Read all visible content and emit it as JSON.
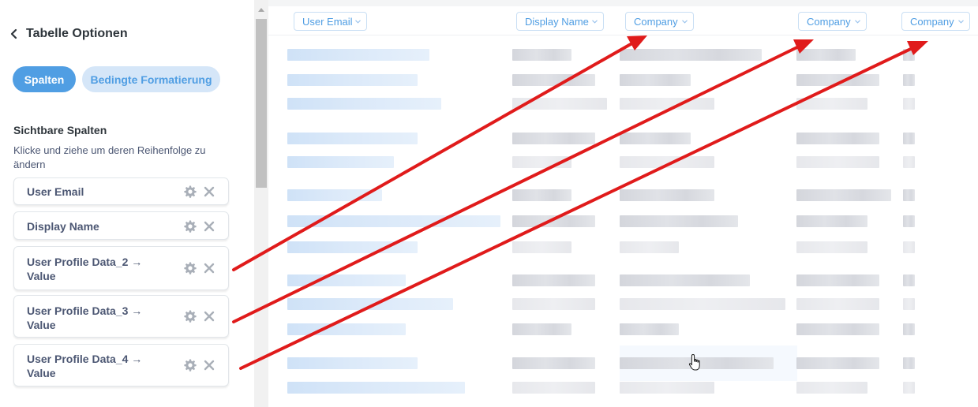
{
  "panel": {
    "title": "Tabelle Optionen",
    "tabs": {
      "active": "Spalten",
      "inactive": "Bedingte Formatierung"
    },
    "section_title": "Sichtbare Spalten",
    "section_desc": "Klicke und ziehe um deren Reihenfolge zu ändern",
    "columns": [
      {
        "label": "User Email"
      },
      {
        "label": "Display Name"
      },
      {
        "label": "User Profile Data_2 → Value"
      },
      {
        "label": "User Profile Data_3 → Value"
      },
      {
        "label": "User Profile Data_4 → Value"
      }
    ]
  },
  "table": {
    "headers": [
      "User Email",
      "Display Name",
      "Company",
      "Company",
      "Company"
    ]
  },
  "icons": {
    "back": "chevron-left-icon",
    "settings": "gear-icon",
    "remove": "close-icon",
    "header_dropdown": "chevron-down-icon",
    "pointer": "hand-pointer-icon"
  },
  "colors": {
    "accent": "#509ee3",
    "accent_light": "#d5e6f8",
    "annotation_arrow": "#e01b1b"
  }
}
